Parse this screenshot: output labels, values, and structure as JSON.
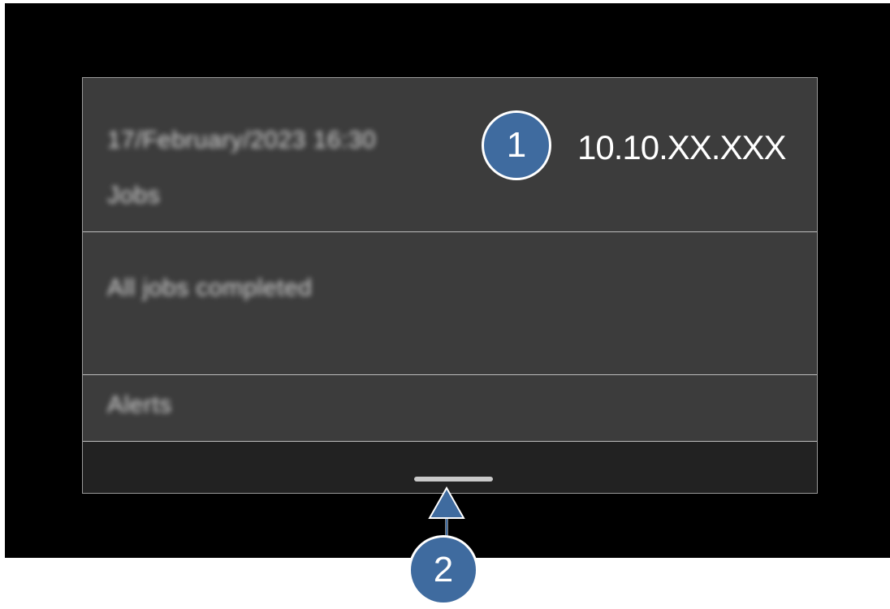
{
  "panel": {
    "header": {
      "datetime": "17/February/2023 16:30",
      "jobs_label": "Jobs",
      "ip_address": "10.10.XX.XXX"
    },
    "status": {
      "text": "All jobs completed"
    },
    "alerts": {
      "label": "Alerts"
    }
  },
  "callouts": {
    "one": "1",
    "two": "2"
  },
  "colors": {
    "callout_fill": "#3f6b9f",
    "panel_bg": "#3a3a3a",
    "screen_bg": "#000000"
  }
}
